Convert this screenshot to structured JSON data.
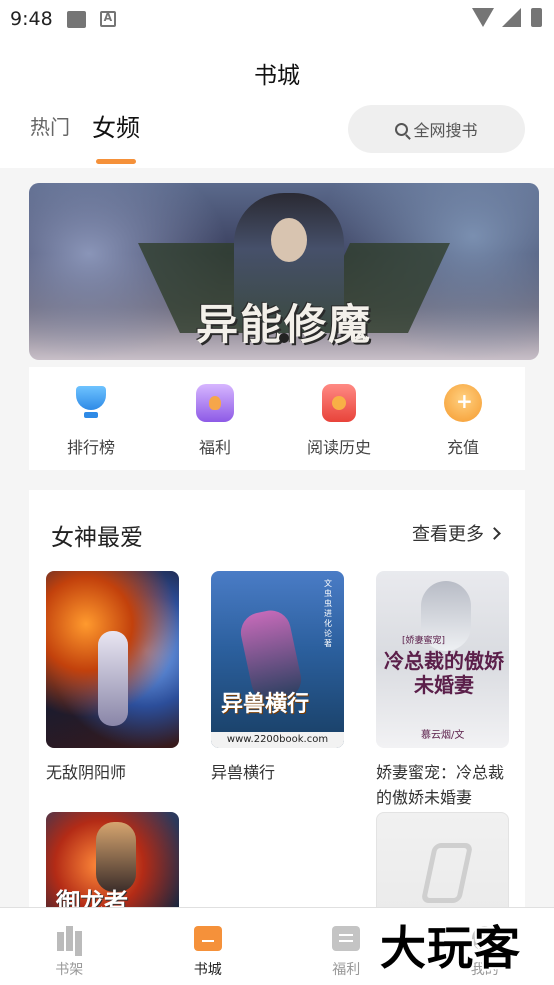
{
  "status_bar": {
    "time": "9:48"
  },
  "header": {
    "title": "书城",
    "tabs": [
      {
        "label": "热门",
        "active": false
      },
      {
        "label": "女频",
        "active": true
      }
    ],
    "search_label": "全网搜书"
  },
  "banner": {
    "title": "异能修魔"
  },
  "quick_nav": [
    {
      "label": "排行榜",
      "icon": "trophy-icon"
    },
    {
      "label": "福利",
      "icon": "gift-icon"
    },
    {
      "label": "阅读历史",
      "icon": "history-icon"
    },
    {
      "label": "充值",
      "icon": "recharge-icon"
    }
  ],
  "section": {
    "title": "女神最爱",
    "more_label": "查看更多",
    "books": [
      {
        "title": "无敌阴阳师"
      },
      {
        "title": "异兽横行",
        "cover_title": "异兽横行",
        "cover_author": "文 虫虫进化论 著",
        "cover_url": "www.2200book.com"
      },
      {
        "title": "娇妻蜜宠：冷总裁的傲娇未婚妻",
        "cover_title": "冷总裁的傲娇未婚妻",
        "cover_sub": "[娇妻蜜宠]",
        "cover_author": "慕云烟/文"
      },
      {
        "title": "",
        "cover_title": "御龙者"
      },
      {
        "title": ""
      }
    ]
  },
  "bottom_nav": [
    {
      "label": "书架",
      "icon": "bookshelf-icon",
      "active": false
    },
    {
      "label": "书城",
      "icon": "store-icon",
      "active": true
    },
    {
      "label": "福利",
      "icon": "welfare-icon",
      "active": false
    },
    {
      "label": "我的",
      "icon": "profile-icon",
      "active": false
    }
  ],
  "watermark": "大玩客",
  "colors": {
    "accent": "#f5913a",
    "background": "#f5f5f5"
  }
}
